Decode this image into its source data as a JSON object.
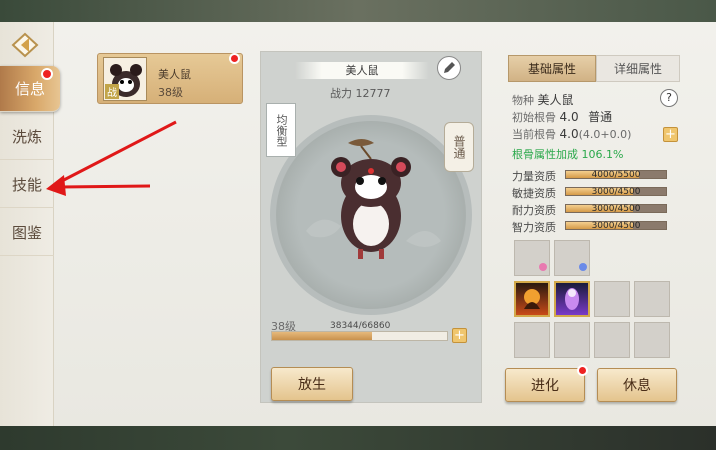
{
  "nav": {
    "items": [
      {
        "label": "信息",
        "active": true
      },
      {
        "label": "洗炼",
        "active": false
      },
      {
        "label": "技能",
        "active": false
      },
      {
        "label": "图鉴",
        "active": false
      }
    ]
  },
  "pet_card": {
    "name": "美人鼠",
    "level": "38级",
    "badge": "战"
  },
  "center": {
    "pet_name": "美人鼠",
    "power": "战力 12777",
    "type_tag": "均衡型",
    "rank_tag": "普通",
    "level": "38级",
    "exp": "38344/66860",
    "exp_fraction": 0.573,
    "release_button": "放生"
  },
  "tabs": {
    "basic": "基础属性",
    "detail": "详细属性"
  },
  "info": {
    "species_label": "物种",
    "species_value": "美人鼠",
    "initial_root_label": "初始根骨",
    "initial_root_value": "4.0",
    "initial_root_grade": "普通",
    "current_root_label": "当前根骨",
    "current_root_value": "4.0",
    "current_root_detail": "(4.0+0.0)",
    "bonus": "根骨属性加成 106.1%"
  },
  "stats": [
    {
      "label": "力量资质",
      "value": "4000/5500",
      "fraction": 0.727
    },
    {
      "label": "敏捷资质",
      "value": "3000/4500",
      "fraction": 0.667
    },
    {
      "label": "耐力资质",
      "value": "3000/4500",
      "fraction": 0.667
    },
    {
      "label": "智力资质",
      "value": "3000/4500",
      "fraction": 0.667
    }
  ],
  "buttons": {
    "evolve": "进化",
    "rest": "休息"
  },
  "colors": {
    "accent_gold": "#d9a86a",
    "bonus_green": "#2aa84a",
    "alert_red": "#e22222",
    "arrow_red": "#e01818"
  }
}
